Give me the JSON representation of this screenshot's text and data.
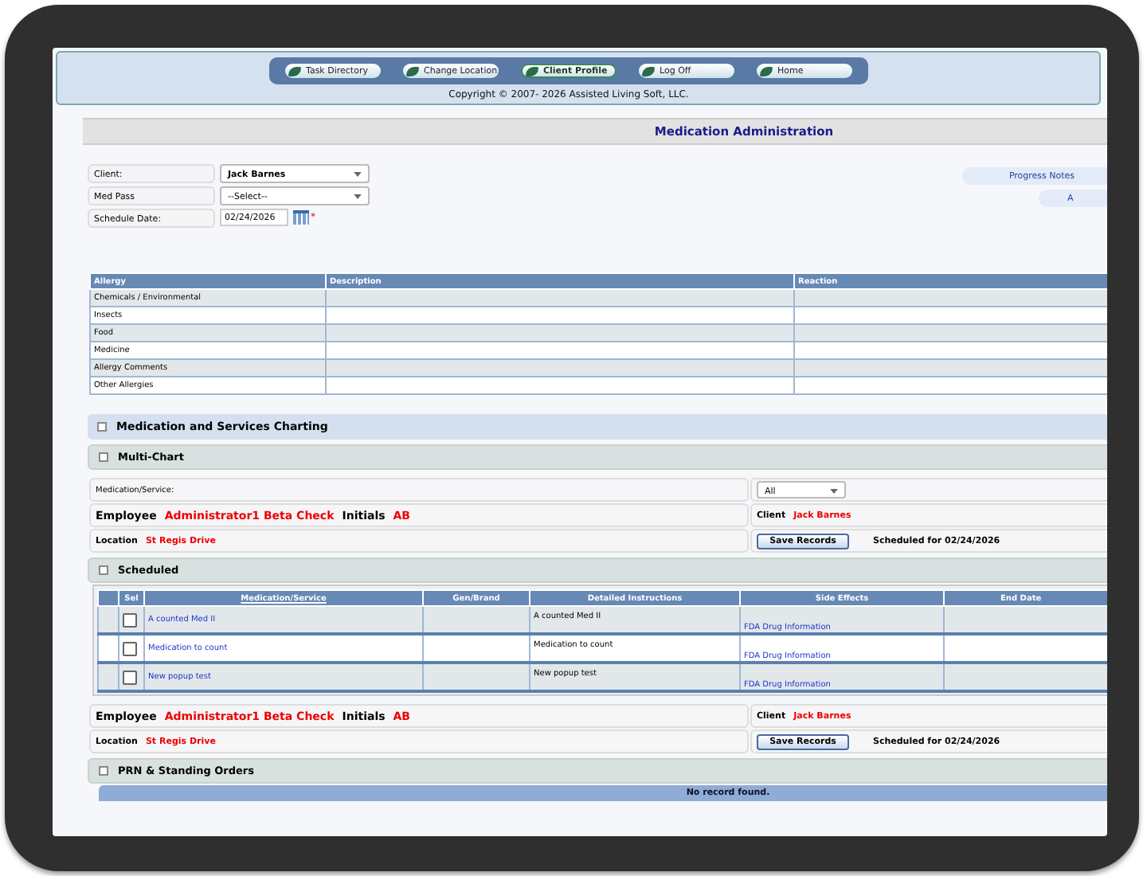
{
  "nav": {
    "items": [
      {
        "label": "Task Directory",
        "selected": false
      },
      {
        "label": "Change Location",
        "selected": false
      },
      {
        "label": "Client Profile",
        "selected": true
      },
      {
        "label": "Log Off",
        "selected": false
      },
      {
        "label": "Home",
        "selected": false
      }
    ],
    "copyright": "Copyright © 2007- 2026 Assisted Living Soft, LLC."
  },
  "page_title": "Medication Administration",
  "form": {
    "client_label": "Client:",
    "client_value": "Jack Barnes",
    "med_pass_label": "Med Pass",
    "med_pass_value": "--Select--",
    "date_label": "Schedule Date:",
    "date_value": "02/24/2026",
    "required_mark": "*"
  },
  "side_buttons": [
    "Progress Notes",
    "A"
  ],
  "allergy_table": {
    "columns": [
      "Allergy",
      "Description",
      "Reaction"
    ],
    "rows": [
      "Chemicals / Environmental",
      "Insects",
      "Food",
      "Medicine",
      "Allergy Comments",
      "Other Allergies"
    ]
  },
  "charting_title": "Medication and Services Charting",
  "multi_chart": {
    "title": "Multi-Chart",
    "med_label": "Medication/Service:",
    "med_filter": "All"
  },
  "info_blocks": [
    {
      "employee_label": "Employee",
      "employee": "Administrator1 Beta Check",
      "initials_label": "Initials",
      "initials": "AB",
      "client_label": "Client",
      "client": "Jack Barnes",
      "location_label": "Location",
      "location": "St Regis Drive",
      "save": "Save Records",
      "scheduled": "Scheduled for 02/24/2026"
    },
    {
      "employee_label": "Employee",
      "employee": "Administrator1 Beta Check",
      "initials_label": "Initials",
      "initials": "AB",
      "client_label": "Client",
      "client": "Jack Barnes",
      "location_label": "Location",
      "location": "St Regis Drive",
      "save": "Save Records",
      "scheduled": "Scheduled for 02/24/2026"
    }
  ],
  "scheduled": {
    "title": "Scheduled",
    "columns": [
      "Sel",
      "Medication/Service",
      "Gen/Brand",
      "Detailed Instructions",
      "Side Effects",
      "End Date"
    ],
    "rows": [
      {
        "checked": false,
        "medication": "A counted Med II",
        "instructions": "A counted Med II",
        "side_effects": "FDA Drug Information"
      },
      {
        "checked": false,
        "medication": "Medication to count",
        "instructions": "Medication to count",
        "side_effects": "FDA Drug Information"
      },
      {
        "checked": false,
        "medication": "New popup test",
        "instructions": "New popup test",
        "side_effects": "FDA Drug Information"
      }
    ]
  },
  "prn": {
    "title": "PRN & Standing Orders",
    "empty": "No record found."
  }
}
